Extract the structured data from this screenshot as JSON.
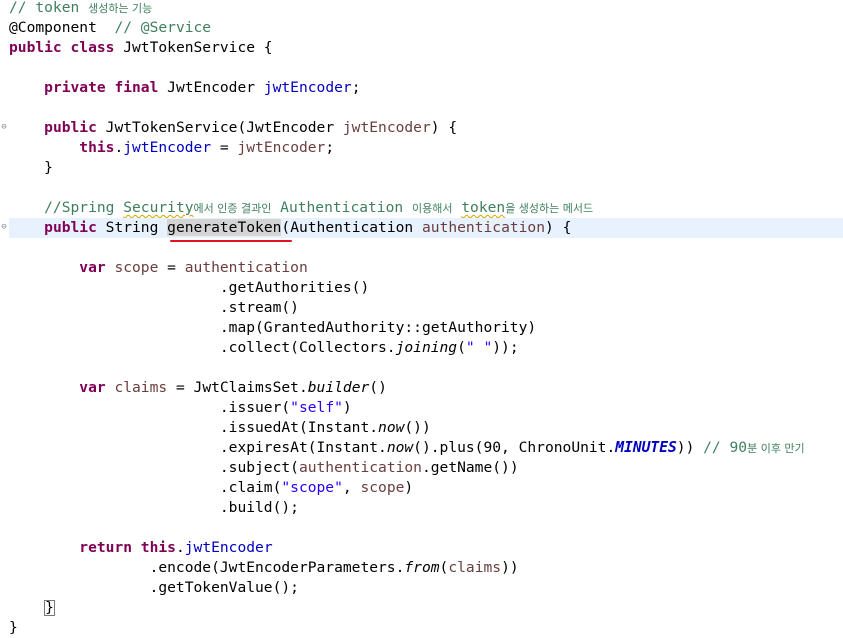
{
  "editor": {
    "lines": [
      {
        "segments": [
          {
            "t": "// token ",
            "c": "cm"
          },
          {
            "t": "생성하는 기능",
            "c": "cm ko"
          }
        ]
      },
      {
        "segments": [
          {
            "t": "@Component  ",
            "c": ""
          },
          {
            "t": "// @Service",
            "c": "cm"
          }
        ]
      },
      {
        "segments": [
          {
            "t": "public class",
            "c": "kw"
          },
          {
            "t": " JwtTokenService {",
            "c": ""
          }
        ]
      },
      {
        "segments": []
      },
      {
        "segments": [
          {
            "t": "    ",
            "c": ""
          },
          {
            "t": "private final",
            "c": "kw"
          },
          {
            "t": " JwtEncoder ",
            "c": ""
          },
          {
            "t": "jwtEncoder",
            "c": "fld"
          },
          {
            "t": ";",
            "c": ""
          }
        ]
      },
      {
        "segments": []
      },
      {
        "segments": [
          {
            "t": "    ",
            "c": ""
          },
          {
            "t": "public",
            "c": "kw"
          },
          {
            "t": " JwtTokenService(JwtEncoder ",
            "c": ""
          },
          {
            "t": "jwtEncoder",
            "c": "prm"
          },
          {
            "t": ") {",
            "c": ""
          }
        ]
      },
      {
        "segments": [
          {
            "t": "        ",
            "c": ""
          },
          {
            "t": "this",
            "c": "kw"
          },
          {
            "t": ".",
            "c": ""
          },
          {
            "t": "jwtEncoder",
            "c": "fld"
          },
          {
            "t": " = ",
            "c": ""
          },
          {
            "t": "jwtEncoder",
            "c": "prm"
          },
          {
            "t": ";",
            "c": ""
          }
        ]
      },
      {
        "segments": [
          {
            "t": "    }",
            "c": ""
          }
        ]
      },
      {
        "segments": []
      },
      {
        "segments": [
          {
            "t": "    //Spring ",
            "c": "cm"
          },
          {
            "t": "Security",
            "c": "cm sq"
          },
          {
            "t": "에서 인증 결과인",
            "c": "cm ko"
          },
          {
            "t": " Authentication ",
            "c": "cm"
          },
          {
            "t": "이용해서",
            "c": "cm ko"
          },
          {
            "t": " ",
            "c": "cm"
          },
          {
            "t": "token",
            "c": "cm sq"
          },
          {
            "t": "을 생성하는 메서드",
            "c": "cm ko"
          }
        ]
      },
      {
        "segments": [
          {
            "t": "    ",
            "c": ""
          },
          {
            "t": "public",
            "c": "kw"
          },
          {
            "t": " String ",
            "c": ""
          },
          {
            "t": "generateToken",
            "c": "hl"
          },
          {
            "t": "(Authentication ",
            "c": ""
          },
          {
            "t": "authentication",
            "c": "prm"
          },
          {
            "t": ") {",
            "c": ""
          }
        ],
        "current": true
      },
      {
        "segments": []
      },
      {
        "segments": [
          {
            "t": "        ",
            "c": ""
          },
          {
            "t": "var",
            "c": "kw"
          },
          {
            "t": " ",
            "c": ""
          },
          {
            "t": "scope",
            "c": "prm"
          },
          {
            "t": " = ",
            "c": ""
          },
          {
            "t": "authentication",
            "c": "prm"
          }
        ]
      },
      {
        "segments": [
          {
            "t": "                        .getAuthorities()",
            "c": ""
          }
        ]
      },
      {
        "segments": [
          {
            "t": "                        .stream()",
            "c": ""
          }
        ]
      },
      {
        "segments": [
          {
            "t": "                        .map(GrantedAuthority::getAuthority)",
            "c": ""
          }
        ]
      },
      {
        "segments": [
          {
            "t": "                        .collect(Collectors.",
            "c": ""
          },
          {
            "t": "joining",
            "c": "it"
          },
          {
            "t": "(",
            "c": ""
          },
          {
            "t": "\" \"",
            "c": "st"
          },
          {
            "t": "));",
            "c": ""
          }
        ]
      },
      {
        "segments": []
      },
      {
        "segments": [
          {
            "t": "        ",
            "c": ""
          },
          {
            "t": "var",
            "c": "kw"
          },
          {
            "t": " ",
            "c": ""
          },
          {
            "t": "claims",
            "c": "prm"
          },
          {
            "t": " = JwtClaimsSet.",
            "c": ""
          },
          {
            "t": "builder",
            "c": "it"
          },
          {
            "t": "()",
            "c": ""
          }
        ]
      },
      {
        "segments": [
          {
            "t": "                        .issuer(",
            "c": ""
          },
          {
            "t": "\"self\"",
            "c": "st"
          },
          {
            "t": ")",
            "c": ""
          }
        ]
      },
      {
        "segments": [
          {
            "t": "                        .issuedAt(Instant.",
            "c": ""
          },
          {
            "t": "now",
            "c": "it"
          },
          {
            "t": "())",
            "c": ""
          }
        ]
      },
      {
        "segments": [
          {
            "t": "                        .expiresAt(Instant.",
            "c": ""
          },
          {
            "t": "now",
            "c": "it"
          },
          {
            "t": "().plus(90, ChronoUnit.",
            "c": ""
          },
          {
            "t": "MINUTES",
            "c": "st-itb"
          },
          {
            "t": ")) ",
            "c": ""
          },
          {
            "t": "// 90",
            "c": "cm"
          },
          {
            "t": "분 이후 만기",
            "c": "cm ko"
          }
        ]
      },
      {
        "segments": [
          {
            "t": "                        .subject(",
            "c": ""
          },
          {
            "t": "authentication",
            "c": "prm"
          },
          {
            "t": ".getName())",
            "c": ""
          }
        ]
      },
      {
        "segments": [
          {
            "t": "                        .claim(",
            "c": ""
          },
          {
            "t": "\"scope\"",
            "c": "st"
          },
          {
            "t": ", ",
            "c": ""
          },
          {
            "t": "scope",
            "c": "prm"
          },
          {
            "t": ")",
            "c": ""
          }
        ]
      },
      {
        "segments": [
          {
            "t": "                        .build();",
            "c": ""
          }
        ]
      },
      {
        "segments": []
      },
      {
        "segments": [
          {
            "t": "        ",
            "c": ""
          },
          {
            "t": "return this",
            "c": "kw"
          },
          {
            "t": ".",
            "c": ""
          },
          {
            "t": "jwtEncoder",
            "c": "fld"
          }
        ]
      },
      {
        "segments": [
          {
            "t": "                .encode(JwtEncoderParameters.",
            "c": ""
          },
          {
            "t": "from",
            "c": "it"
          },
          {
            "t": "(",
            "c": ""
          },
          {
            "t": "claims",
            "c": "prm"
          },
          {
            "t": "))",
            "c": ""
          }
        ]
      },
      {
        "segments": [
          {
            "t": "                .getTokenValue();",
            "c": ""
          }
        ]
      },
      {
        "segments": [
          {
            "t": "    ",
            "c": ""
          },
          {
            "t": "}",
            "c": "box"
          }
        ]
      },
      {
        "segments": [
          {
            "t": "}",
            "c": ""
          }
        ]
      }
    ]
  },
  "ruler": {
    "fold_markers": [
      6,
      11
    ]
  },
  "colors": {
    "keyword": "#7f0055",
    "field": "#0000c0",
    "comment": "#3f7f5f",
    "string": "#2a00ff",
    "parameter": "#6a3e3e",
    "annotation_underline": "#e0141e",
    "current_line": "#e8f2fe"
  }
}
